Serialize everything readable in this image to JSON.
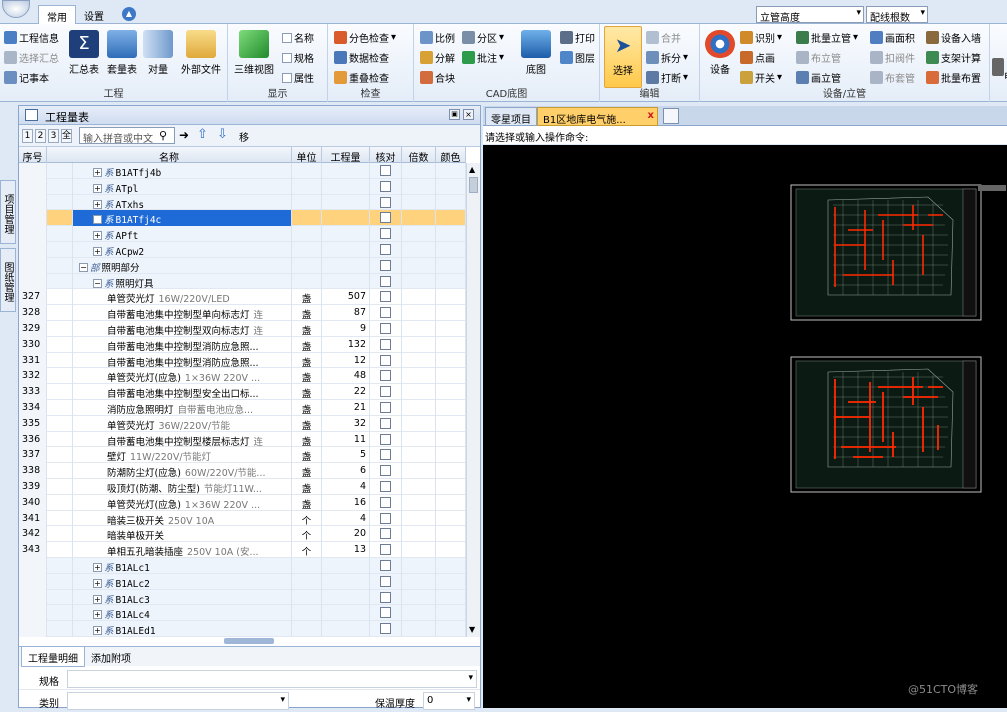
{
  "ribbon": {
    "tabs": [
      "常用",
      "设置"
    ],
    "groups": {
      "project": {
        "label": "工程",
        "items": [
          "工程信息",
          "选择汇总",
          "记事本"
        ],
        "big": [
          "汇总表",
          "套量表",
          "对量",
          "外部文件"
        ]
      },
      "display": {
        "label": "显示",
        "big": "三维视图",
        "items": [
          "名称",
          "规格",
          "属性"
        ]
      },
      "check": {
        "label": "检查",
        "items": [
          "分色检查",
          "数据检查",
          "重叠检查"
        ]
      },
      "cad": {
        "label": "CAD底图",
        "items": [
          "比例",
          "分区",
          "分解",
          "批注",
          "合块"
        ],
        "big": "底图",
        "side": [
          "打印",
          "图层"
        ]
      },
      "edit": {
        "label": "编辑",
        "big": "选择",
        "items": [
          "合并",
          "拆分",
          "打断"
        ]
      },
      "device": {
        "label": "设备/立管",
        "big": "设备",
        "items": [
          "识别",
          "批量立管",
          "画面积",
          "设备入墙",
          "点画",
          "布立管",
          "扣阀件",
          "支架计算",
          "开关",
          "画立管",
          "布套管",
          "批量布置"
        ]
      },
      "extra": {
        "label": "电"
      }
    },
    "dropdowns": {
      "riser_height": "立管高度",
      "wire_count": "配线根数"
    }
  },
  "panel": {
    "title": "工程量表",
    "levels": [
      "1",
      "2",
      "3",
      "全"
    ],
    "search_placeholder": "输入拼音或中文",
    "move_label": "移",
    "columns": [
      "序号",
      "名称",
      "单位",
      "工程量",
      "核对",
      "倍数",
      "颜色"
    ],
    "rows": [
      {
        "seq": "",
        "indent": 2,
        "expand": "+",
        "prefix": "系",
        "name": "B1ATfj4b",
        "spec": "",
        "unit": "",
        "qty": "",
        "kind": "group"
      },
      {
        "seq": "",
        "indent": 2,
        "expand": "+",
        "prefix": "系",
        "name": "ATpl",
        "spec": "",
        "unit": "",
        "qty": "",
        "kind": "group"
      },
      {
        "seq": "",
        "indent": 2,
        "expand": "+",
        "prefix": "系",
        "name": "ATxhs",
        "spec": "",
        "unit": "",
        "qty": "",
        "kind": "group"
      },
      {
        "seq": "",
        "indent": 2,
        "expand": "+",
        "prefix": "系",
        "name": "B1ATfj4c",
        "spec": "",
        "unit": "",
        "qty": "",
        "kind": "selected"
      },
      {
        "seq": "",
        "indent": 2,
        "expand": "+",
        "prefix": "系",
        "name": "APft",
        "spec": "",
        "unit": "",
        "qty": "",
        "kind": "group"
      },
      {
        "seq": "",
        "indent": 2,
        "expand": "+",
        "prefix": "系",
        "name": "ACpw2",
        "spec": "",
        "unit": "",
        "qty": "",
        "kind": "group"
      },
      {
        "seq": "",
        "indent": 1,
        "expand": "-",
        "prefix": "部",
        "name": "照明部分",
        "spec": "",
        "unit": "",
        "qty": "",
        "kind": "group"
      },
      {
        "seq": "",
        "indent": 2,
        "expand": "-",
        "prefix": "系",
        "name": "照明灯具",
        "spec": "",
        "unit": "",
        "qty": "",
        "kind": "group"
      },
      {
        "seq": "327",
        "indent": 3,
        "expand": "",
        "prefix": "",
        "name": "单管荧光灯",
        "spec": "16W/220V/LED",
        "unit": "盏",
        "qty": "507",
        "kind": "item"
      },
      {
        "seq": "328",
        "indent": 3,
        "expand": "",
        "prefix": "",
        "name": "自带蓄电池集中控制型单向标志灯",
        "spec": "连",
        "unit": "盏",
        "qty": "87",
        "kind": "item"
      },
      {
        "seq": "329",
        "indent": 3,
        "expand": "",
        "prefix": "",
        "name": "自带蓄电池集中控制型双向标志灯",
        "spec": "连",
        "unit": "盏",
        "qty": "9",
        "kind": "item"
      },
      {
        "seq": "330",
        "indent": 3,
        "expand": "",
        "prefix": "",
        "name": "自带蓄电池集中控制型消防应急照...",
        "spec": "",
        "unit": "盏",
        "qty": "132",
        "kind": "item"
      },
      {
        "seq": "331",
        "indent": 3,
        "expand": "",
        "prefix": "",
        "name": "自带蓄电池集中控制型消防应急照...",
        "spec": "",
        "unit": "盏",
        "qty": "12",
        "kind": "item"
      },
      {
        "seq": "332",
        "indent": 3,
        "expand": "",
        "prefix": "",
        "name": "单管荧光灯(应急)",
        "spec": "1×36W 220V  ...",
        "unit": "盏",
        "qty": "48",
        "kind": "item"
      },
      {
        "seq": "333",
        "indent": 3,
        "expand": "",
        "prefix": "",
        "name": "自带蓄电池集中控制型安全出口标...",
        "spec": "",
        "unit": "盏",
        "qty": "22",
        "kind": "item"
      },
      {
        "seq": "334",
        "indent": 3,
        "expand": "",
        "prefix": "",
        "name": "消防应急照明灯",
        "spec": "自带蓄电池应急...",
        "unit": "盏",
        "qty": "21",
        "kind": "item"
      },
      {
        "seq": "335",
        "indent": 3,
        "expand": "",
        "prefix": "",
        "name": "单管荧光灯",
        "spec": "36W/220V/节能",
        "unit": "盏",
        "qty": "32",
        "kind": "item"
      },
      {
        "seq": "336",
        "indent": 3,
        "expand": "",
        "prefix": "",
        "name": "自带蓄电池集中控制型楼层标志灯",
        "spec": "连",
        "unit": "盏",
        "qty": "11",
        "kind": "item"
      },
      {
        "seq": "337",
        "indent": 3,
        "expand": "",
        "prefix": "",
        "name": "壁灯",
        "spec": "11W/220V/节能灯",
        "unit": "盏",
        "qty": "5",
        "kind": "item"
      },
      {
        "seq": "338",
        "indent": 3,
        "expand": "",
        "prefix": "",
        "name": "防潮防尘灯(应急)",
        "spec": "60W/220V/节能...",
        "unit": "盏",
        "qty": "6",
        "kind": "item"
      },
      {
        "seq": "339",
        "indent": 3,
        "expand": "",
        "prefix": "",
        "name": "吸顶灯(防潮、防尘型)",
        "spec": "节能灯11W...",
        "unit": "盏",
        "qty": "4",
        "kind": "item"
      },
      {
        "seq": "340",
        "indent": 3,
        "expand": "",
        "prefix": "",
        "name": "单管荧光灯(应急)",
        "spec": "1×36W 220V  ...",
        "unit": "盏",
        "qty": "16",
        "kind": "item"
      },
      {
        "seq": "341",
        "indent": 3,
        "expand": "",
        "prefix": "",
        "name": "暗装三极开关",
        "spec": "250V 10A",
        "unit": "个",
        "qty": "4",
        "kind": "item"
      },
      {
        "seq": "342",
        "indent": 3,
        "expand": "",
        "prefix": "",
        "name": "暗装单极开关",
        "spec": "",
        "unit": "个",
        "qty": "20",
        "kind": "item"
      },
      {
        "seq": "343",
        "indent": 3,
        "expand": "",
        "prefix": "",
        "name": "单相五孔暗装插座",
        "spec": "250V 10A (安...",
        "unit": "个",
        "qty": "13",
        "kind": "item"
      },
      {
        "seq": "",
        "indent": 2,
        "expand": "+",
        "prefix": "系",
        "name": "B1ALc1",
        "spec": "",
        "unit": "",
        "qty": "",
        "kind": "group"
      },
      {
        "seq": "",
        "indent": 2,
        "expand": "+",
        "prefix": "系",
        "name": "B1ALc2",
        "spec": "",
        "unit": "",
        "qty": "",
        "kind": "group"
      },
      {
        "seq": "",
        "indent": 2,
        "expand": "+",
        "prefix": "系",
        "name": "B1ALc3",
        "spec": "",
        "unit": "",
        "qty": "",
        "kind": "group"
      },
      {
        "seq": "",
        "indent": 2,
        "expand": "+",
        "prefix": "系",
        "name": "B1ALc4",
        "spec": "",
        "unit": "",
        "qty": "",
        "kind": "group"
      },
      {
        "seq": "",
        "indent": 2,
        "expand": "+",
        "prefix": "系",
        "name": "B1ALEd1",
        "spec": "",
        "unit": "",
        "qty": "",
        "kind": "group"
      }
    ],
    "bottom_tabs": [
      "工程量明细",
      "添加附项"
    ],
    "props": {
      "spec_label": "规格",
      "type_label": "类别",
      "insulation_label": "保温厚度",
      "insulation_value": "0"
    }
  },
  "side_tabs": [
    "项目管理",
    "图纸管理"
  ],
  "doc_tabs": [
    "零星项目",
    "B1区地库电气施...",
    "x"
  ],
  "command_prompt": "请选择或输入操作命令:",
  "watermark": "@51CTO博客",
  "colors": {
    "accent": "#1e6ad6",
    "selected_row": "#ffd27d",
    "canvas": "#000000",
    "drawing_red": "#ff2a00"
  }
}
